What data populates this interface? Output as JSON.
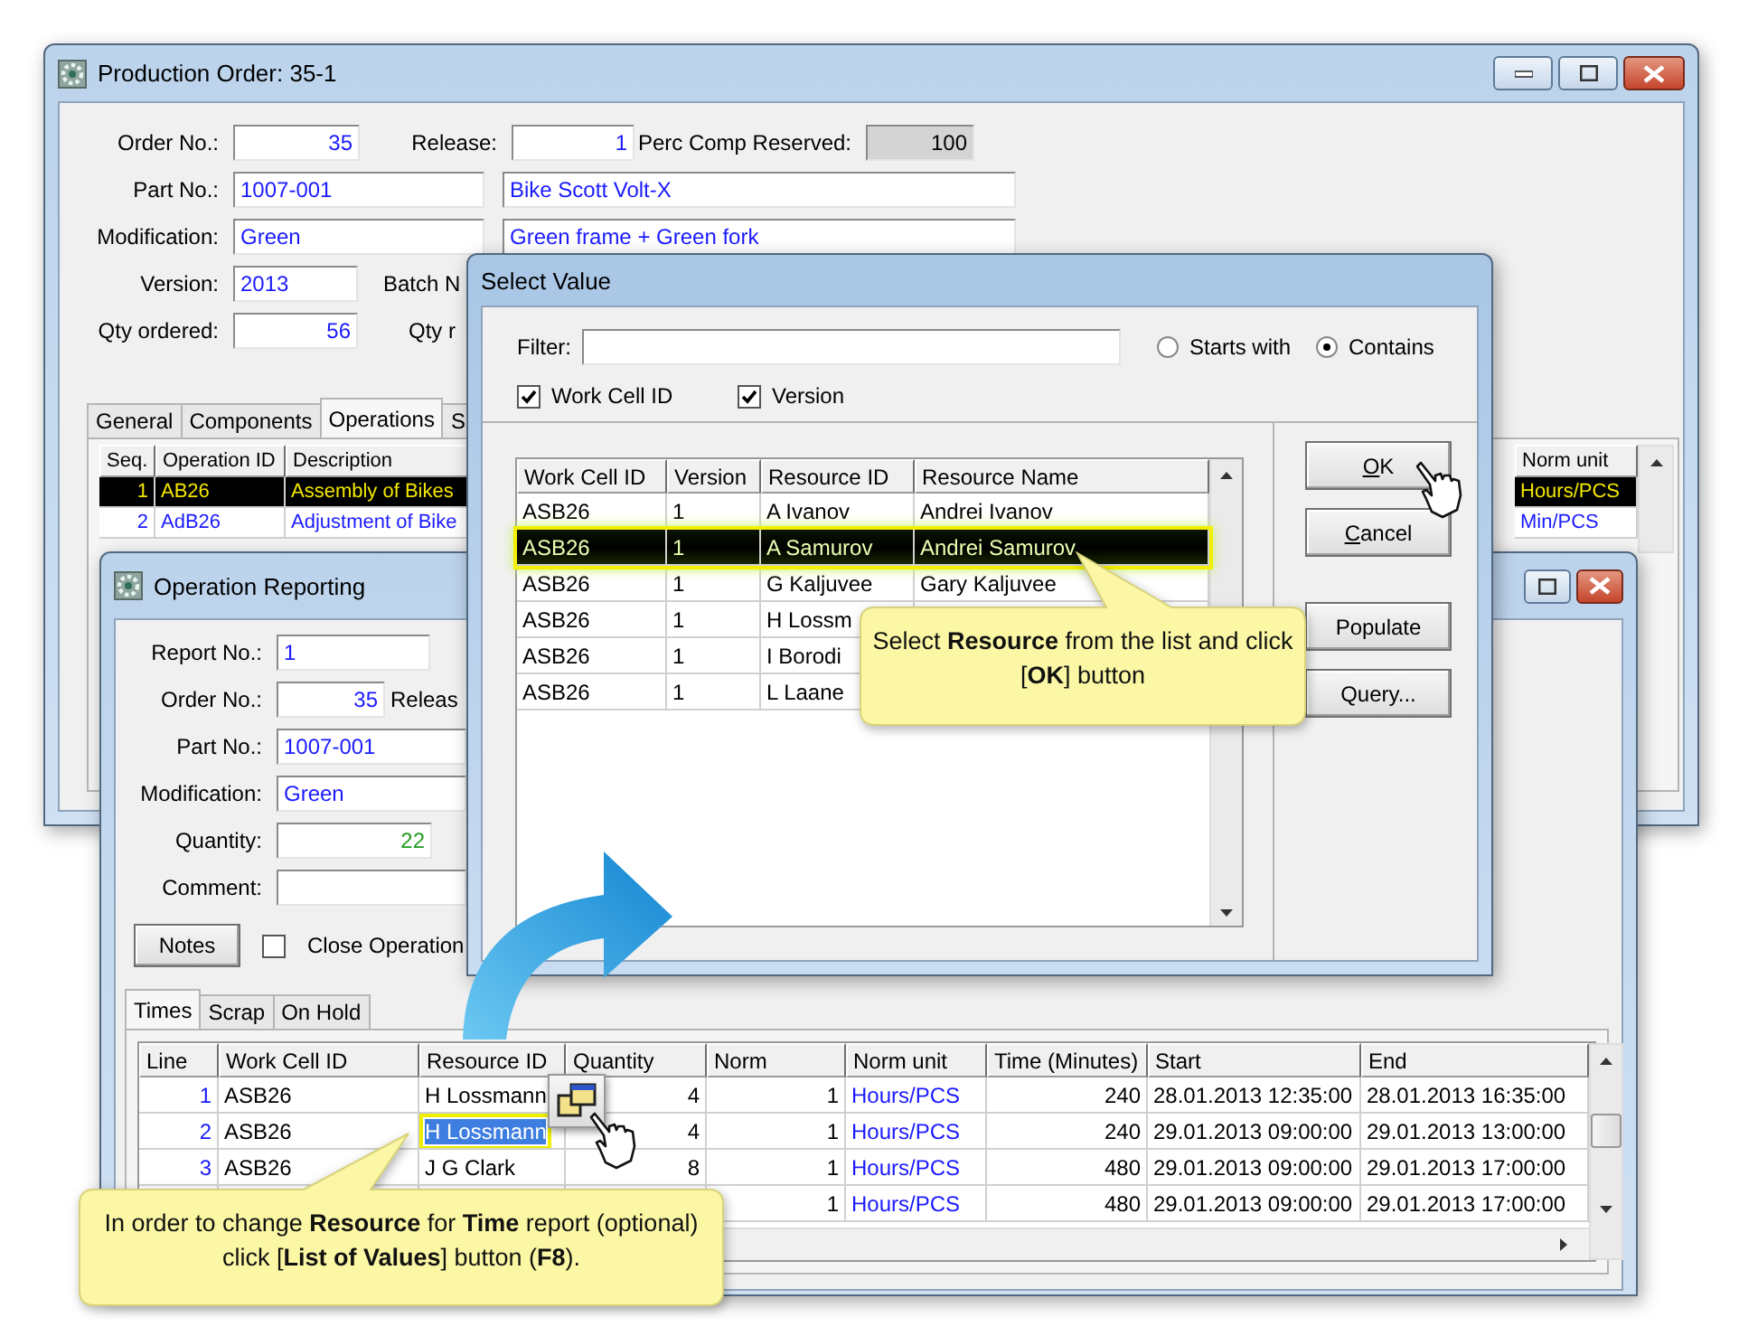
{
  "production_order": {
    "title": "Production Order: 35-1",
    "order_no": {
      "label": "Order No.:",
      "value": "35"
    },
    "release": {
      "label": "Release:",
      "value": "1"
    },
    "perc_comp_reserved": {
      "label": "Perc Comp Reserved:",
      "value": "100"
    },
    "part_no": {
      "label": "Part No.:",
      "value": "1007-001",
      "description": "Bike Scott Volt-X"
    },
    "modification": {
      "label": "Modification:",
      "value": "Green",
      "description": "Green frame + Green fork"
    },
    "version": {
      "label": "Version:",
      "value": "2013"
    },
    "batch": {
      "label": "Batch N"
    },
    "qty_ordered": {
      "label": "Qty ordered:",
      "value": "56"
    },
    "qty_2": {
      "label": "Qty r"
    },
    "tabs": [
      {
        "label": "General",
        "selected": false
      },
      {
        "label": "Components",
        "selected": false
      },
      {
        "label": "Operations",
        "selected": true
      },
      {
        "label": "S",
        "selected": false
      }
    ],
    "operations": {
      "columns": [
        "Seq.",
        "Operation ID",
        "Description"
      ],
      "norm_unit_column": "Norm unit",
      "rows": [
        {
          "seq": "1",
          "operation_id": "AB26",
          "description": "Assembly of Bikes",
          "norm_unit": "Hours/PCS",
          "selected": true
        },
        {
          "seq": "2",
          "operation_id": "AdB26",
          "description": "Adjustment of Bike",
          "norm_unit": "Min/PCS",
          "selected": false
        }
      ]
    }
  },
  "operation_reporting": {
    "title": "Operation Reporting",
    "report_no": {
      "label": "Report No.:",
      "value": "1"
    },
    "order_no": {
      "label": "Order No.:",
      "value": "35"
    },
    "release": {
      "label": "Releas"
    },
    "part_no": {
      "label": "Part No.:",
      "value": "1007-001"
    },
    "modification": {
      "label": "Modification:",
      "value": "Green"
    },
    "quantity": {
      "label": "Quantity:",
      "value": "22"
    },
    "comment": {
      "label": "Comment:"
    },
    "notes_button": "Notes",
    "close_operation": {
      "label": "Close Operation",
      "checked": false
    },
    "tabs": [
      {
        "label": "Times",
        "selected": true
      },
      {
        "label": "Scrap",
        "selected": false
      },
      {
        "label": "On Hold",
        "selected": false
      }
    ],
    "times": {
      "columns": [
        "Line",
        "Work Cell ID",
        "Resource ID",
        "Quantity",
        "Norm",
        "Norm unit",
        "Time (Minutes)",
        "Start",
        "End"
      ],
      "rows": [
        {
          "line": "1",
          "work_cell": "ASB26",
          "resource": "H Lossmann",
          "quantity": "4",
          "norm": "1",
          "norm_unit": "Hours/PCS",
          "time": "240",
          "start": "28.01.2013 12:35:00",
          "end": "28.01.2013 16:35:00",
          "selected": false
        },
        {
          "line": "2",
          "work_cell": "ASB26",
          "resource": "H Lossmann",
          "quantity": "4",
          "norm": "1",
          "norm_unit": "Hours/PCS",
          "time": "240",
          "start": "29.01.2013 09:00:00",
          "end": "29.01.2013 13:00:00",
          "selected": true
        },
        {
          "line": "3",
          "work_cell": "ASB26",
          "resource": "J G Clark",
          "quantity": "8",
          "norm": "1",
          "norm_unit": "Hours/PCS",
          "time": "480",
          "start": "29.01.2013 09:00:00",
          "end": "29.01.2013 17:00:00",
          "selected": false
        },
        {
          "norm": "1",
          "norm_unit": "Hours/PCS",
          "time": "480",
          "start": "29.01.2013 09:00:00",
          "end": "29.01.2013 17:00:00"
        }
      ]
    }
  },
  "select_value": {
    "title": "Select Value",
    "filter": {
      "label": "Filter:"
    },
    "match_modes": [
      {
        "label": "Starts with",
        "selected": false
      },
      {
        "label": "Contains",
        "selected": true
      }
    ],
    "column_toggles": [
      {
        "label": "Work Cell ID",
        "checked": true
      },
      {
        "label": "Version",
        "checked": true
      }
    ],
    "columns": [
      "Work Cell ID",
      "Version",
      "Resource ID",
      "Resource Name"
    ],
    "rows": [
      {
        "work_cell": "ASB26",
        "version": "1",
        "resource_id": "A Ivanov",
        "resource_name": "Andrei Ivanov",
        "selected": false
      },
      {
        "work_cell": "ASB26",
        "version": "1",
        "resource_id": "A Samurov",
        "resource_name": "Andrei Samurov",
        "selected": true
      },
      {
        "work_cell": "ASB26",
        "version": "1",
        "resource_id": "G Kaljuvee",
        "resource_name": "Gary Kaljuvee",
        "selected": false
      },
      {
        "work_cell": "ASB26",
        "version": "1",
        "resource_id": "H Lossm",
        "selected": false
      },
      {
        "work_cell": "ASB26",
        "version": "1",
        "resource_id": "I Borodi",
        "selected": false
      },
      {
        "work_cell": "ASB26",
        "version": "1",
        "resource_id": "L Laane",
        "selected": false
      }
    ],
    "buttons": [
      {
        "label": "OK",
        "access_key": true
      },
      {
        "label": "Cancel",
        "access_key": true
      },
      {
        "label": "Populate",
        "access_key": false
      },
      {
        "label": "Query...",
        "access_key": false
      }
    ]
  },
  "callouts": [
    {
      "text": "Select **Resource** from the list and click [**OK**] button"
    },
    {
      "text": "In order to change **Resource** for **Time** report (optional) click [**List of Values**] button (**F8**)."
    }
  ]
}
